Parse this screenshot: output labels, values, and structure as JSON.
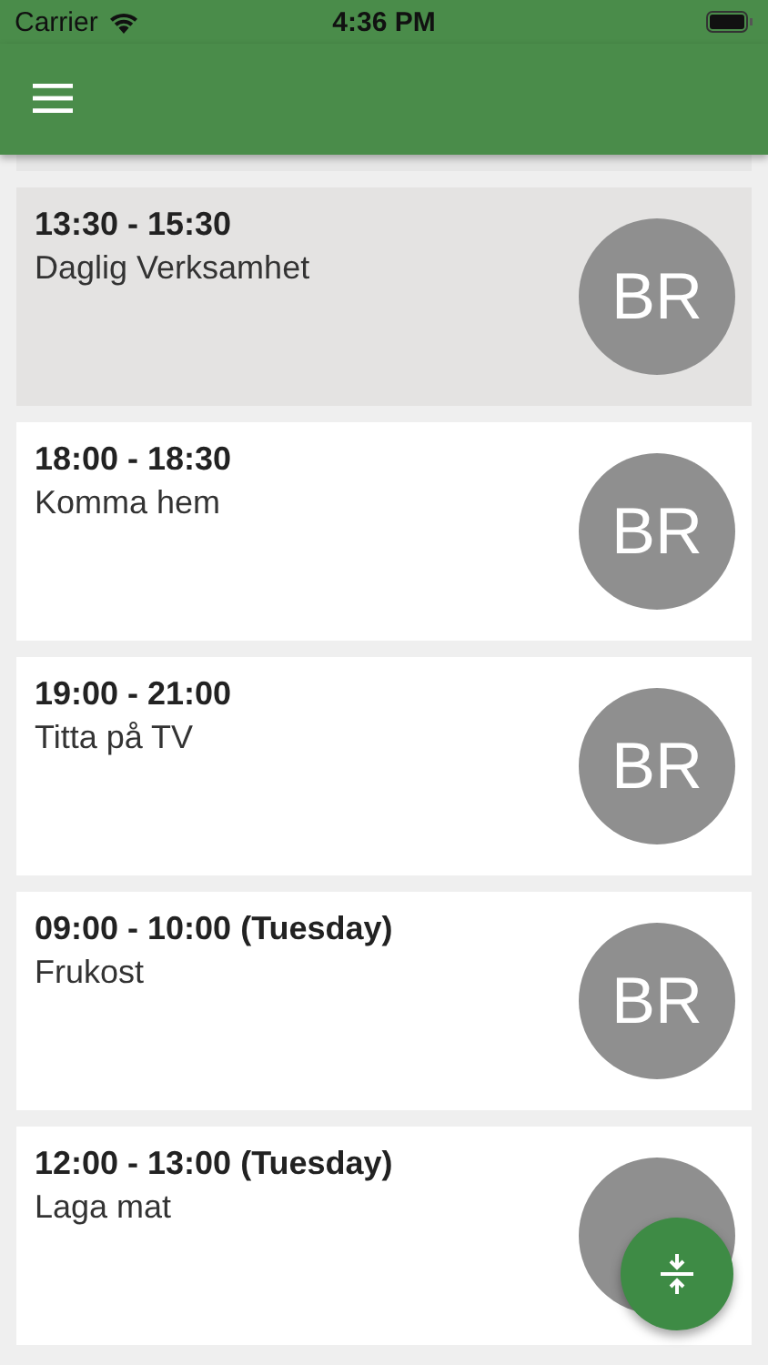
{
  "status_bar": {
    "carrier": "Carrier",
    "time": "4:36 PM"
  },
  "events": [
    {
      "time": "13:30 - 15:30",
      "title": "Daglig Verksamhet",
      "initials": "BR",
      "selected": true
    },
    {
      "time": "18:00 - 18:30",
      "title": "Komma hem",
      "initials": "BR",
      "selected": false
    },
    {
      "time": "19:00 - 21:00",
      "title": "Titta på TV",
      "initials": "BR",
      "selected": false
    },
    {
      "time": "09:00 - 10:00 (Tuesday)",
      "title": "Frukost",
      "initials": "BR",
      "selected": false
    },
    {
      "time": "12:00 - 13:00 (Tuesday)",
      "title": "Laga mat",
      "selected": false
    }
  ]
}
